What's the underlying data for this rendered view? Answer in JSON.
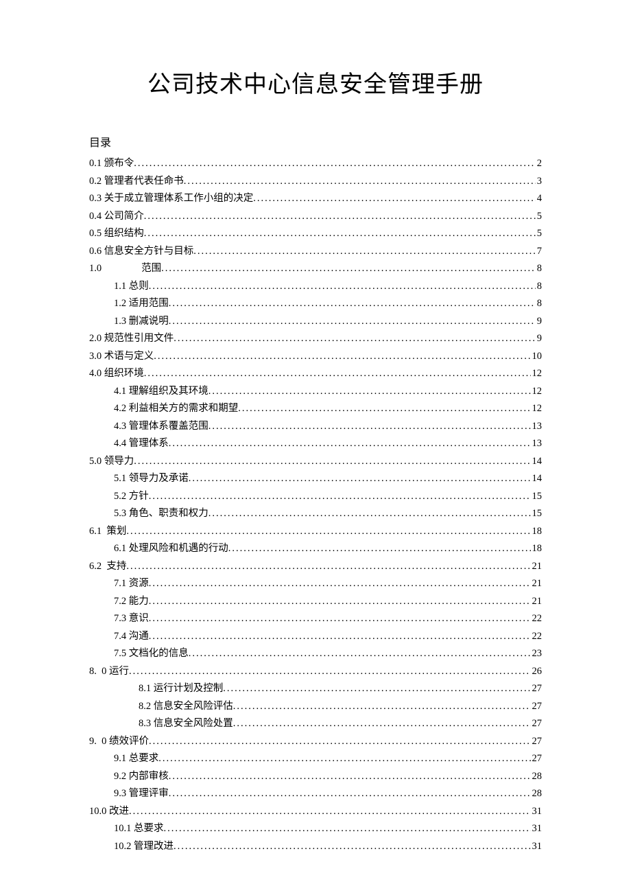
{
  "title": "公司技术中心信息安全管理手册",
  "toc_header": "目录",
  "entries": [
    {
      "label": "0.1 颁布令",
      "page": "2",
      "indent": 0
    },
    {
      "label": "0.2 管理者代表任命书",
      "page": "3",
      "indent": 0
    },
    {
      "label": "0.3 关于成立管理体系工作小组的决定",
      "page": "4",
      "indent": 0
    },
    {
      "label": "0.4 公司简介",
      "page": "5",
      "indent": 0
    },
    {
      "label": "0.5 组织结构",
      "page": "5",
      "indent": 0
    },
    {
      "label": "0.6 信息安全方针与目标",
      "page": "7",
      "indent": 0
    },
    {
      "label": "1.0　　　　范围",
      "page": "8",
      "indent": 0
    },
    {
      "label": "1.1 总则",
      "page": "8",
      "indent": 1
    },
    {
      "label": "1.2 适用范围",
      "page": "8",
      "indent": 1
    },
    {
      "label": "1.3 删减说明",
      "page": "9",
      "indent": 1
    },
    {
      "label": "2.0 规范性引用文件",
      "page": "9",
      "indent": 0
    },
    {
      "label": "3.0 术语与定义",
      "page": "10",
      "indent": 0
    },
    {
      "label": "4.0 组织环境",
      "page": "12",
      "indent": 0
    },
    {
      "label": "4.1 理解组织及其环境",
      "page": "12",
      "indent": 1
    },
    {
      "label": "4.2 利益相关方的需求和期望",
      "page": "12",
      "indent": 1
    },
    {
      "label": "4.3 管理体系覆盖范围",
      "page": "13",
      "indent": 1
    },
    {
      "label": "4.4 管理体系",
      "page": "13",
      "indent": 1
    },
    {
      "label": "5.0 领导力",
      "page": "14",
      "indent": 0
    },
    {
      "label": "5.1 领导力及承诺",
      "page": "14",
      "indent": 1
    },
    {
      "label": "5.2 方针",
      "page": "15",
      "indent": 1
    },
    {
      "label": "5.3 角色、职责和权力",
      "page": "15",
      "indent": 1
    },
    {
      "label": "6.1  策划",
      "page": "18",
      "indent": 0
    },
    {
      "label": "6.1 处理风险和机遇的行动",
      "page": "18",
      "indent": 1
    },
    {
      "label": "6.2  支持",
      "page": "21",
      "indent": 0
    },
    {
      "label": "7.1 资源",
      "page": "21",
      "indent": 1
    },
    {
      "label": "7.2 能力",
      "page": "21",
      "indent": 1
    },
    {
      "label": "7.3 意识",
      "page": "22",
      "indent": 1
    },
    {
      "label": "7.4 沟通",
      "page": "22",
      "indent": 1
    },
    {
      "label": "7.5 文档化的信息",
      "page": "23",
      "indent": 1
    },
    {
      "label": "8.  0 运行",
      "page": "26",
      "indent": 0
    },
    {
      "label": "8.1 运行计划及控制",
      "page": "27",
      "indent": 2
    },
    {
      "label": "8.2 信息安全风险评估",
      "page": "27",
      "indent": 2
    },
    {
      "label": "8.3 信息安全风险处置",
      "page": "27",
      "indent": 2
    },
    {
      "label": "9.  0 绩效评价",
      "page": "27",
      "indent": 0
    },
    {
      "label": "9.1 总要求",
      "page": "27",
      "indent": 1
    },
    {
      "label": "9.2 内部审核",
      "page": "28",
      "indent": 1
    },
    {
      "label": "9.3 管理评审",
      "page": "28",
      "indent": 1
    },
    {
      "label": "10.0 改进",
      "page": "31",
      "indent": 0
    },
    {
      "label": "10.1 总要求",
      "page": "31",
      "indent": 1
    },
    {
      "label": "10.2 管理改进",
      "page": "31",
      "indent": 1
    }
  ]
}
